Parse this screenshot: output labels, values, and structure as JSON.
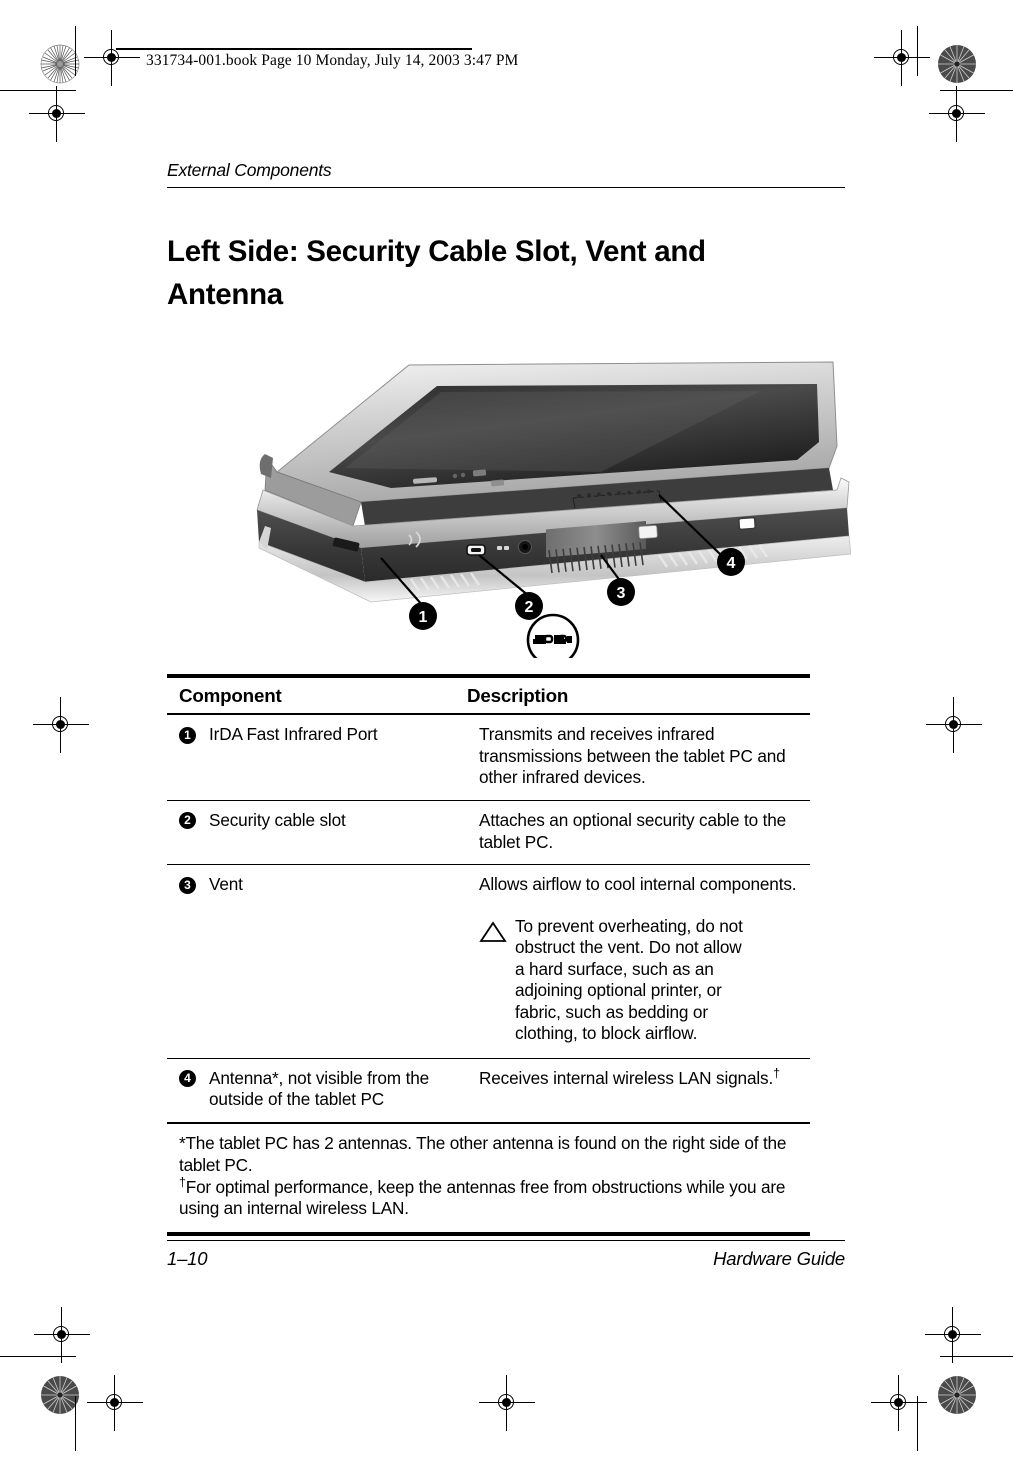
{
  "print_header": {
    "text": "331734-001.book  Page 10  Monday, July 14, 2003  3:47 PM"
  },
  "running_head": "External Components",
  "page_title": "Left Side: Security Cable Slot, Vent and Antenna",
  "figure": {
    "alt": "Left side view of tablet PC showing infrared port, security cable slot, vent and antenna",
    "callouts": [
      "1",
      "2",
      "3",
      "4"
    ],
    "security_lock_icon": "security-cable-lock-icon"
  },
  "table": {
    "headers": {
      "component": "Component",
      "description": "Description"
    },
    "rows": [
      {
        "number": "1",
        "component": "IrDA Fast Infrared Port",
        "description": "Transmits and receives infrared transmissions between the tablet PC and other infrared devices."
      },
      {
        "number": "2",
        "component": "Security cable slot",
        "description": "Attaches an optional security cable to the tablet PC."
      },
      {
        "number": "3",
        "component": "Vent",
        "description": "Allows airflow to cool internal components.",
        "caution": "To prevent overheating, do not obstruct the vent. Do not allow a hard surface, such as an adjoining optional printer, or fabric, such as bedding or clothing, to block airflow."
      },
      {
        "number": "4",
        "component": "Antenna*, not visible from the outside of the tablet PC",
        "description": "Receives internal wireless LAN signals.",
        "description_dagger": "†"
      }
    ],
    "footnotes": {
      "asterisk": "*The tablet PC has 2 antennas. The other antenna is found on the right side of the tablet PC.",
      "dagger_symbol": "†",
      "dagger": "For optimal performance, keep the antennas free from obstructions while you are using an internal wireless LAN."
    }
  },
  "footer": {
    "page_number": "1–10",
    "guide_name": "Hardware Guide"
  },
  "colors": {
    "ink": "#000000",
    "paper": "#ffffff"
  }
}
